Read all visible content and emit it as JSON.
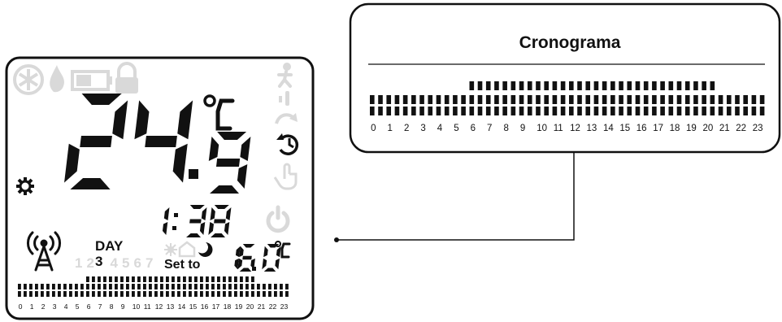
{
  "thermostat": {
    "temperature": {
      "digits": "24",
      "decimal": "9",
      "unit": "°C"
    },
    "clock": "1:38",
    "day": {
      "label": "DAY",
      "value": "3",
      "days": [
        "1",
        "2",
        "3",
        "4",
        "5",
        "6",
        "7"
      ]
    },
    "setpoint": {
      "label": "Set to",
      "value": "16.0",
      "unit": "°C"
    },
    "schedule": {
      "hours": [
        "0",
        "1",
        "2",
        "3",
        "4",
        "5",
        "6",
        "7",
        "8",
        "9",
        "10",
        "11",
        "12",
        "13",
        "14",
        "15",
        "16",
        "17",
        "18",
        "19",
        "20",
        "21",
        "22",
        "23"
      ],
      "comfort_start_hour": 6,
      "comfort_end_hour": 21
    },
    "icons": [
      "snowflake-icon",
      "flame-icon",
      "battery-icon",
      "lock-icon",
      "walking-person-icon",
      "thermometer-icon",
      "redo-arrow-icon",
      "clock-history-icon",
      "hand-pointer-icon",
      "power-icon",
      "settings-gear-icon",
      "antenna-icon",
      "sun-icon",
      "home-icon",
      "moon-icon"
    ]
  },
  "callout": {
    "title": "Cronograma",
    "hours": [
      "0",
      "1",
      "2",
      "3",
      "4",
      "5",
      "6",
      "7",
      "8",
      "9",
      "10",
      "11",
      "12",
      "13",
      "14",
      "15",
      "16",
      "17",
      "18",
      "19",
      "20",
      "21",
      "22",
      "23"
    ],
    "comfort_start_hour": 6,
    "comfort_end_hour": 21
  },
  "colors": {
    "active": "#111111",
    "inactive": "#d9d9d9",
    "frame": "#111111"
  }
}
